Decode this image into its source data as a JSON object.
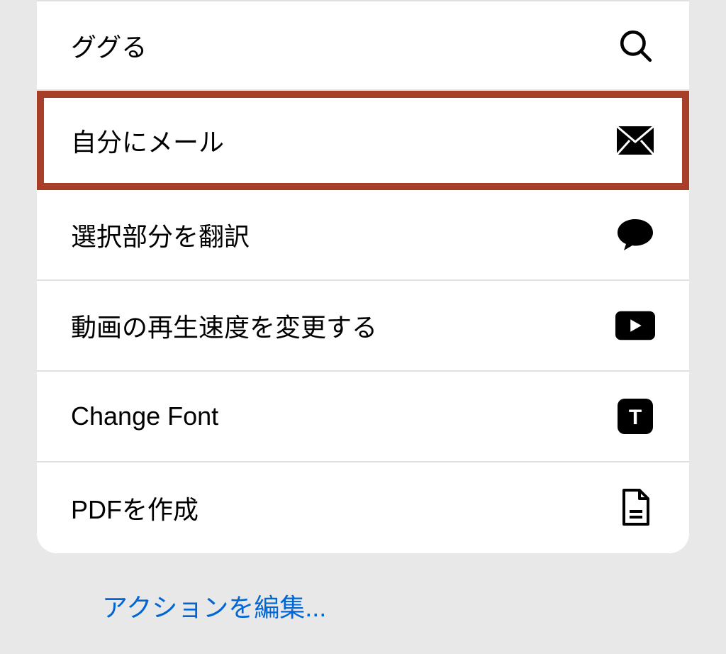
{
  "actions": [
    {
      "label": "ググる",
      "icon": "search",
      "highlighted": false
    },
    {
      "label": "自分にメール",
      "icon": "mail",
      "highlighted": true
    },
    {
      "label": "選択部分を翻訳",
      "icon": "chat",
      "highlighted": false
    },
    {
      "label": "動画の再生速度を変更する",
      "icon": "video",
      "highlighted": false
    },
    {
      "label": "Change Font",
      "icon": "text",
      "highlighted": false
    },
    {
      "label": "PDFを作成",
      "icon": "document",
      "highlighted": false
    }
  ],
  "footer": {
    "edit_label": "アクションを編集..."
  },
  "colors": {
    "highlight_border": "#a63e28",
    "link": "#0066d6"
  }
}
